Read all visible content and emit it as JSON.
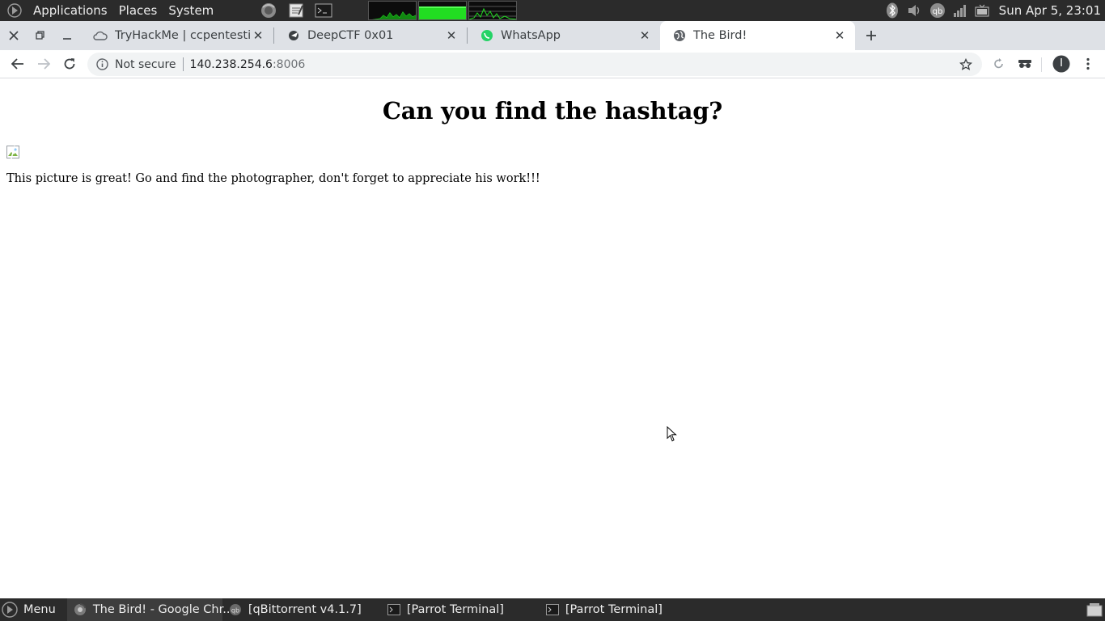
{
  "top_panel": {
    "menus": [
      "Applications",
      "Places",
      "System"
    ],
    "launchers": [
      "firefox-icon",
      "text-editor-icon",
      "terminal-icon"
    ],
    "tray_icons": [
      "bluetooth-icon",
      "volume-icon",
      "qbittorrent-icon",
      "network-signal-icon",
      "battery-icon"
    ],
    "clock": "Sun Apr  5, 23:01"
  },
  "tabs": [
    {
      "title": "TryHackMe | ccpentesting",
      "icon": "cloud-icon",
      "active": false
    },
    {
      "title": "DeepCTF 0x01",
      "icon": "ctf-icon",
      "active": false
    },
    {
      "title": "WhatsApp",
      "icon": "whatsapp-icon",
      "active": false
    },
    {
      "title": "The Bird!",
      "icon": "globe-icon",
      "active": true
    }
  ],
  "toolbar": {
    "security_label": "Not secure",
    "url_host": "140.238.254.6",
    "url_port": ":8006",
    "profile_initial": "I"
  },
  "page": {
    "heading": "Can you find the hashtag?",
    "body_text": "This picture is great! Go and find the photographer, don't forget to appreciate his work!!!"
  },
  "taskbar": {
    "menu_label": "Menu",
    "tasks": [
      {
        "label": "The Bird! - Google Chr...",
        "icon": "chrome-icon",
        "active": true
      },
      {
        "label": "[qBittorrent v4.1.7]",
        "icon": "qbittorrent-icon",
        "active": false
      },
      {
        "label": "[Parrot Terminal]",
        "icon": "terminal-icon",
        "active": false
      },
      {
        "label": "[Parrot Terminal]",
        "icon": "terminal-icon",
        "active": false
      }
    ]
  },
  "colors": {
    "panel_bg": "#2b2b2b",
    "tab_strip_bg": "#dee1e6",
    "omnibox_bg": "#f1f3f4",
    "graph_green": "#22dd22"
  }
}
